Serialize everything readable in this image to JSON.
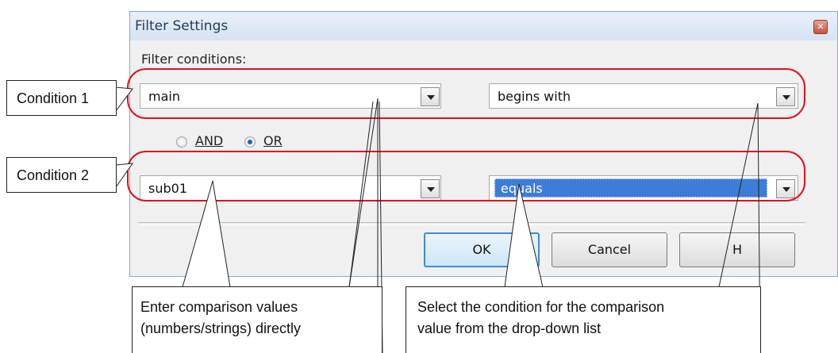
{
  "dialog": {
    "title": "Filter Settings",
    "close_glyph": "✕",
    "filter_conditions_label": "Filter conditions:",
    "condition1": {
      "value": "main",
      "operator": "begins with"
    },
    "logic": {
      "and_label": "AND",
      "or_label": "OR",
      "selected": "OR"
    },
    "condition2": {
      "value": "sub01",
      "operator": "equals"
    },
    "buttons": {
      "ok": "OK",
      "cancel": "Cancel",
      "help": "H"
    }
  },
  "callouts": {
    "condition1": "Condition 1",
    "condition2": "Condition 2",
    "left_note": [
      "Enter comparison values",
      "(numbers/strings) directly"
    ],
    "right_note": [
      "Select the condition for the comparison",
      "value from the drop-down list"
    ]
  },
  "colors": {
    "highlight": "#e1101e",
    "selection": "#3d7dd8"
  }
}
